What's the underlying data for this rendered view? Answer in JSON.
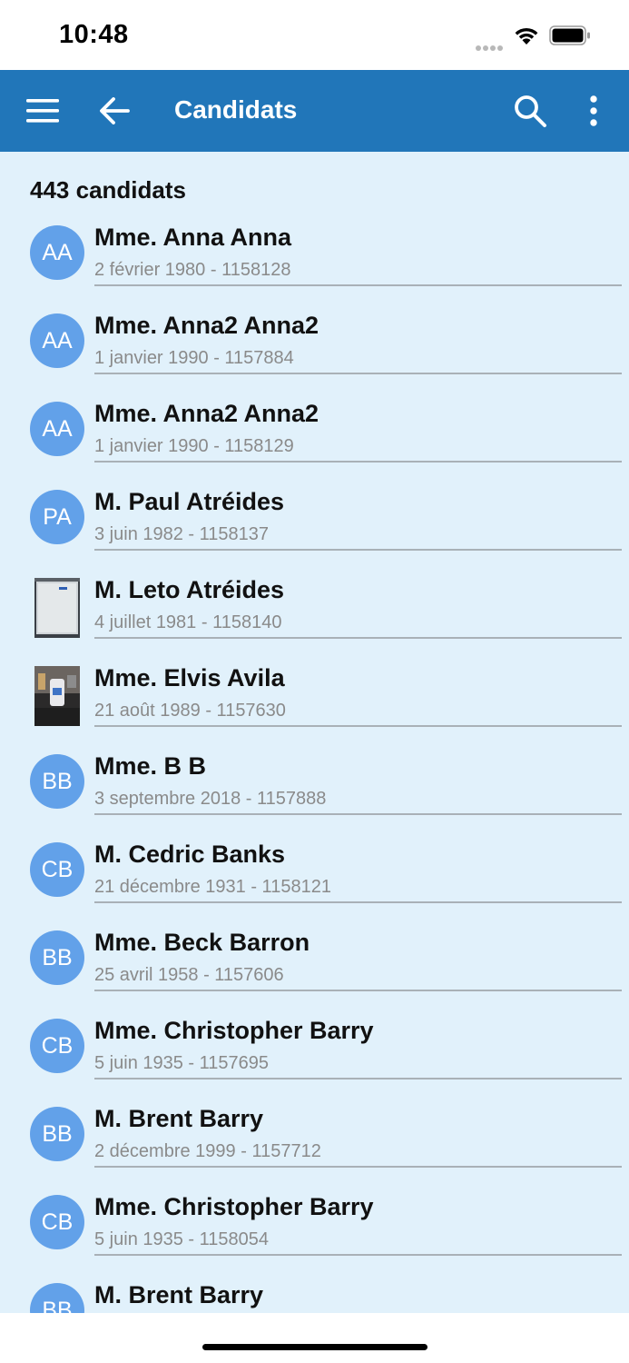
{
  "status_bar": {
    "time": "10:48"
  },
  "app_bar": {
    "title": "Candidats"
  },
  "list": {
    "count_label": "443 candidats",
    "items": [
      {
        "initials": "AA",
        "name": "Mme. Anna Anna",
        "subtitle": "2 février 1980 - 1158128",
        "avatar": "initials"
      },
      {
        "initials": "AA",
        "name": "Mme. Anna2 Anna2",
        "subtitle": "1 janvier 1990 - 1157884",
        "avatar": "initials"
      },
      {
        "initials": "AA",
        "name": "Mme. Anna2 Anna2",
        "subtitle": "1 janvier 1990 - 1158129",
        "avatar": "initials"
      },
      {
        "initials": "PA",
        "name": "M. Paul Atréides",
        "subtitle": "3 juin 1982 - 1158137",
        "avatar": "initials"
      },
      {
        "initials": "",
        "name": "M. Leto Atréides",
        "subtitle": "4 juillet 1981 - 1158140",
        "avatar": "photo-document"
      },
      {
        "initials": "",
        "name": "Mme. Elvis Avila",
        "subtitle": "21 août 1989 - 1157630",
        "avatar": "photo-desk"
      },
      {
        "initials": "BB",
        "name": "Mme. B B",
        "subtitle": "3 septembre 2018 - 1157888",
        "avatar": "initials"
      },
      {
        "initials": "CB",
        "name": "M. Cedric Banks",
        "subtitle": "21 décembre 1931 - 1158121",
        "avatar": "initials"
      },
      {
        "initials": "BB",
        "name": "Mme. Beck Barron",
        "subtitle": "25 avril 1958 - 1157606",
        "avatar": "initials"
      },
      {
        "initials": "CB",
        "name": "Mme. Christopher Barry",
        "subtitle": "5 juin 1935 - 1157695",
        "avatar": "initials"
      },
      {
        "initials": "BB",
        "name": "M. Brent Barry",
        "subtitle": "2 décembre 1999 - 1157712",
        "avatar": "initials"
      },
      {
        "initials": "CB",
        "name": "Mme. Christopher Barry",
        "subtitle": "5 juin 1935 - 1158054",
        "avatar": "initials"
      },
      {
        "initials": "BB",
        "name": "M. Brent Barry",
        "subtitle": "",
        "avatar": "initials"
      }
    ]
  },
  "colors": {
    "app_bar": "#2176b9",
    "background": "#e1f1fb",
    "avatar": "#62a1e9"
  }
}
